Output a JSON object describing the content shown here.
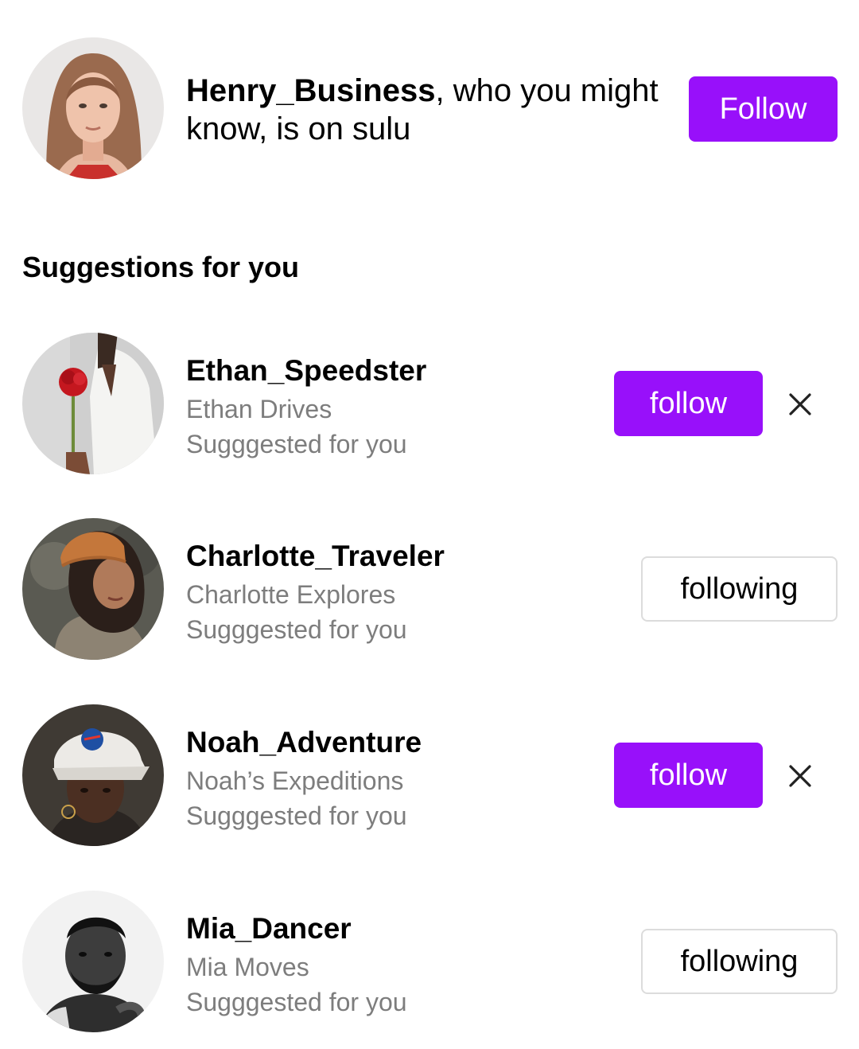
{
  "notification": {
    "username": "Henry_Business",
    "message": ", who you might know, is on sulu",
    "button_label": "Follow"
  },
  "suggestions": {
    "title": "Suggestions for you",
    "items": [
      {
        "username": "Ethan_Speedster",
        "display_name": "Ethan Drives",
        "reason": "Sugggested for you",
        "button_label": "follow",
        "state": "not-following"
      },
      {
        "username": "Charlotte_Traveler",
        "display_name": "Charlotte Explores",
        "reason": "Sugggested for you",
        "button_label": "following",
        "state": "following"
      },
      {
        "username": "Noah_Adventure",
        "display_name": "Noah’s Expeditions",
        "reason": "Sugggested for you",
        "button_label": "follow",
        "state": "not-following"
      },
      {
        "username": "Mia_Dancer",
        "display_name": "Mia Moves",
        "reason": "Sugggested for you",
        "button_label": "following",
        "state": "following"
      }
    ]
  },
  "colors": {
    "accent": "#9810fa",
    "secondary_text": "#7d7d7d",
    "outline_border": "#dcdcdc"
  },
  "icons": {
    "dismiss": "close-icon"
  }
}
